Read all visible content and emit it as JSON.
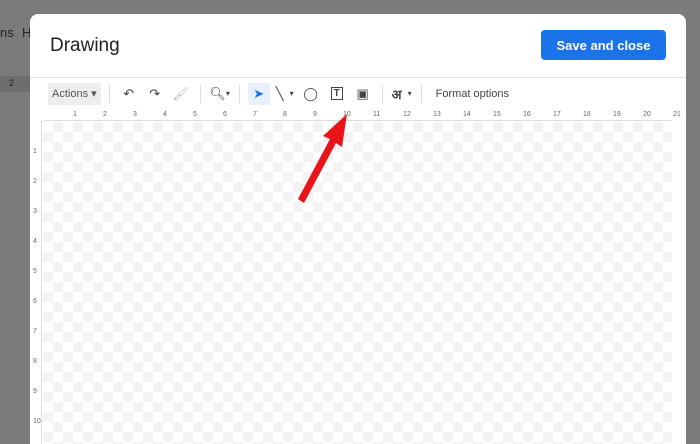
{
  "background": {
    "menu_fragment_1": "ns",
    "menu_fragment_2": "H",
    "ruler_fragment": "2"
  },
  "dialog": {
    "title": "Drawing",
    "save_label": "Save and close"
  },
  "toolbar": {
    "actions_label": "Actions",
    "font_glyph": "अ",
    "format_options": "Format options"
  },
  "ruler": {
    "horizontal": [
      "1",
      "2",
      "3",
      "4",
      "5",
      "6",
      "7",
      "8",
      "9",
      "10",
      "11",
      "12",
      "13",
      "14",
      "15",
      "16",
      "17",
      "18",
      "19",
      "20",
      "21"
    ],
    "vertical": [
      "1",
      "2",
      "3",
      "4",
      "5",
      "6",
      "7",
      "8",
      "9",
      "10"
    ]
  },
  "colors": {
    "accent": "#1a73e8",
    "arrow": "#e8141a"
  }
}
